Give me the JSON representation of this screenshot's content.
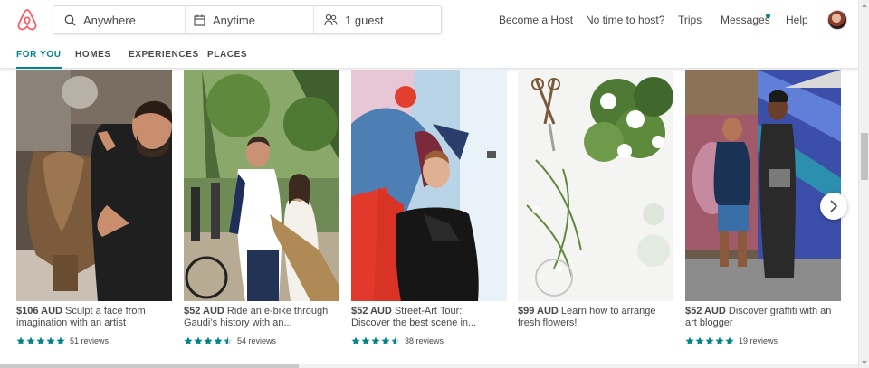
{
  "header": {
    "logo_icon": "airbnb-belo-icon",
    "brand_color": "#FF5A5F",
    "search": {
      "where": {
        "icon": "search-icon",
        "value": "Anywhere"
      },
      "when": {
        "icon": "calendar-icon",
        "value": "Anytime"
      },
      "who": {
        "icon": "guests-icon",
        "value": "1 guest"
      }
    },
    "nav": {
      "host": "Become a Host",
      "no_time": "No time to host?",
      "trips": "Trips",
      "messages": "Messages",
      "help": "Help"
    },
    "messages_dot_color": "#008489"
  },
  "tabs": {
    "items": [
      "FOR YOU",
      "HOMES",
      "EXPERIENCES",
      "PLACES"
    ],
    "active": "FOR YOU",
    "accent": "#008489"
  },
  "cards": [
    {
      "price": "$106 AUD",
      "title_line1": "Sculpt a face from",
      "title_line2": "imagination with an artist",
      "stars": 5,
      "reviews": "51 reviews"
    },
    {
      "price": "$52 AUD",
      "title_line1": "Ride an e-bike through",
      "title_line2": "Gaudi’s history with an...",
      "stars": 4.5,
      "reviews": "54 reviews"
    },
    {
      "price": "$52 AUD",
      "title_line1": "Street-Art Tour:",
      "title_line2": "Discover the best scene in...",
      "stars": 4.5,
      "reviews": "38 reviews"
    },
    {
      "price": "$99 AUD",
      "title_line1": "Learn how to arrange",
      "title_line2": "fresh flowers!",
      "stars": 0,
      "reviews": ""
    },
    {
      "price": "$52 AUD",
      "title_line1": "Discover graffiti with an",
      "title_line2": "art blogger",
      "stars": 5,
      "reviews": "19 reviews"
    }
  ],
  "star_color": "#008489",
  "carousel": {
    "next_icon": "chevron-right-icon"
  }
}
